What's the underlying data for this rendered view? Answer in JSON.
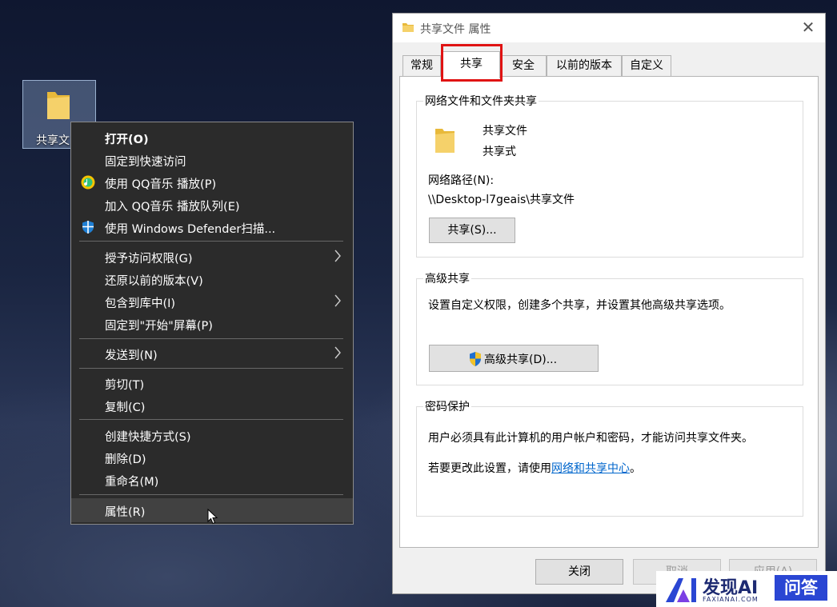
{
  "desktop": {
    "icon_label": "共享文"
  },
  "context_menu": {
    "items": [
      {
        "label": "打开(O)"
      },
      {
        "label": "固定到快速访问"
      },
      {
        "label": "使用 QQ音乐 播放(P)"
      },
      {
        "label": "加入 QQ音乐 播放队列(E)"
      },
      {
        "label": "使用 Windows Defender扫描..."
      },
      {
        "label": "授予访问权限(G)"
      },
      {
        "label": "还原以前的版本(V)"
      },
      {
        "label": "包含到库中(I)"
      },
      {
        "label": "固定到\"开始\"屏幕(P)"
      },
      {
        "label": "发送到(N)"
      },
      {
        "label": "剪切(T)"
      },
      {
        "label": "复制(C)"
      },
      {
        "label": "创建快捷方式(S)"
      },
      {
        "label": "删除(D)"
      },
      {
        "label": "重命名(M)"
      },
      {
        "label": "属性(R)"
      }
    ]
  },
  "dialog": {
    "title": "共享文件 属性",
    "close_symbol": "✕",
    "tabs": [
      "常规",
      "共享",
      "安全",
      "以前的版本",
      "自定义"
    ],
    "network_sharing": {
      "group_label": "网络文件和文件夹共享",
      "folder_name": "共享文件",
      "share_status": "共享式",
      "network_path_label": "网络路径(N):",
      "network_path": "\\\\Desktop-l7geais\\共享文件",
      "share_button": "共享(S)..."
    },
    "advanced_sharing": {
      "group_label": "高级共享",
      "description": "设置自定义权限，创建多个共享，并设置其他高级共享选项。",
      "button": "高级共享(D)..."
    },
    "password_protection": {
      "group_label": "密码保护",
      "description": "用户必须具有此计算机的用户帐户和密码，才能访问共享文件夹。",
      "change_prefix": "若要更改此设置，请使用",
      "link_text": "网络和共享中心",
      "change_suffix": "。"
    },
    "buttons": {
      "close": "关闭",
      "cancel": "取消",
      "apply": "应用(A)"
    }
  },
  "watermark": {
    "brand": "发现AI",
    "site": "FAXIANAI.COM",
    "badge": "问答"
  },
  "colors": {
    "highlight_box": "#e01313",
    "link": "#0066cc",
    "menu_bg": "#2b2b2b"
  }
}
